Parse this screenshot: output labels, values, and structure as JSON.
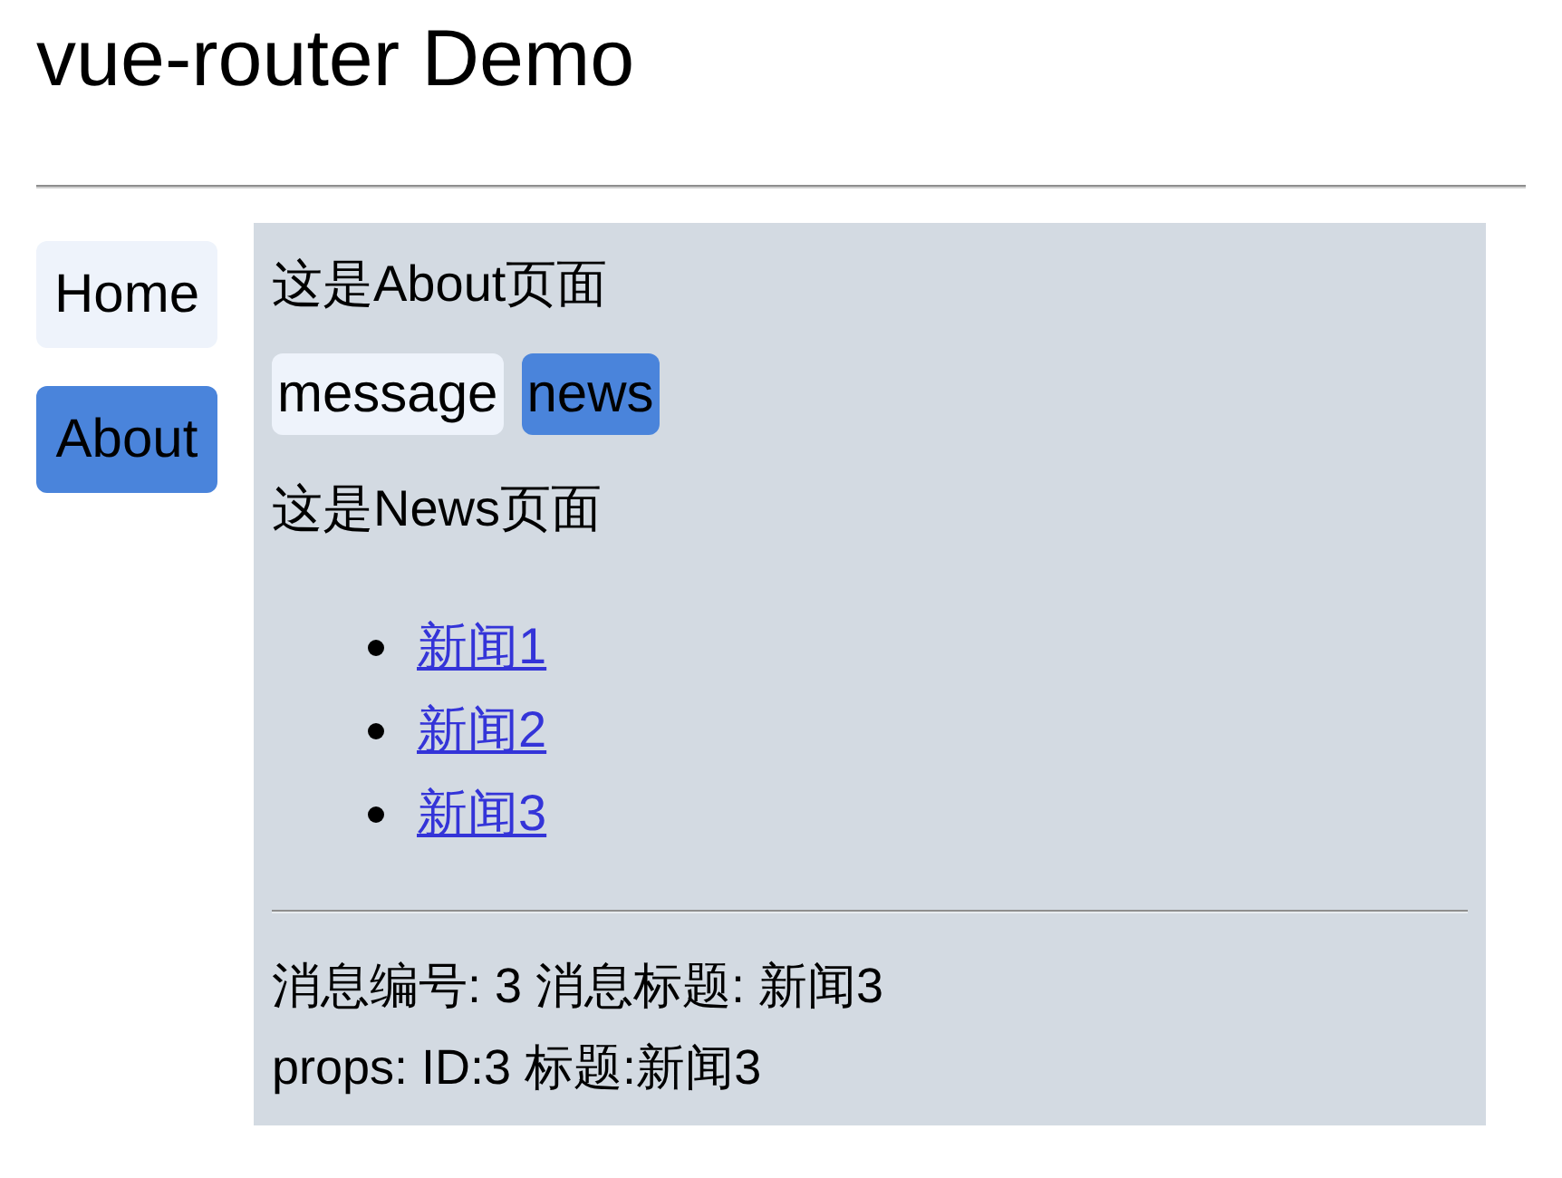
{
  "title": "vue-router Demo",
  "nav": [
    {
      "label": "Home",
      "selected": false
    },
    {
      "label": "About",
      "selected": true
    }
  ],
  "page": {
    "heading": "这是About页面",
    "tabs": [
      {
        "label": "message",
        "selected": false
      },
      {
        "label": "news",
        "selected": true
      }
    ],
    "subheading": "这是News页面",
    "news_links": [
      "新闻1",
      "新闻2",
      "新闻3"
    ],
    "detail_lines": [
      "消息编号: 3 消息标题: 新闻3",
      "props: ID:3 标题:新闻3"
    ]
  }
}
